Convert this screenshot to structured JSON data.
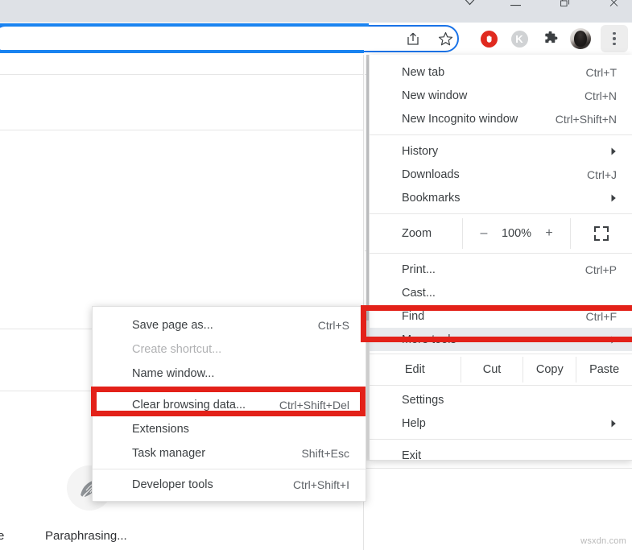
{
  "window": {
    "controls": [
      {
        "name": "chevron-down",
        "glyph": "chevron"
      },
      {
        "name": "minimize",
        "glyph": "minimize"
      },
      {
        "name": "restore",
        "glyph": "restore"
      },
      {
        "name": "close",
        "glyph": "close"
      }
    ]
  },
  "toolbar": {
    "omnibox_value": "",
    "omnibox_placeholder": "",
    "icons": [
      {
        "name": "share-icon",
        "label": "Share"
      },
      {
        "name": "bookmark-star-icon",
        "label": "Bookmark this tab"
      },
      {
        "name": "adblock-icon",
        "label": "AdBlock"
      },
      {
        "name": "kaspersky-icon",
        "label": "K"
      },
      {
        "name": "extensions-puzzle-icon",
        "label": "Extensions"
      },
      {
        "name": "avatar-icon",
        "label": "Profile"
      },
      {
        "name": "three-dot-menu-icon",
        "label": "Customize and control Google Chrome"
      }
    ]
  },
  "chrome_menu": {
    "groups": [
      {
        "items": [
          {
            "label": "New tab",
            "accel": "Ctrl+T",
            "arrow": false,
            "highlight": false
          },
          {
            "label": "New window",
            "accel": "Ctrl+N",
            "arrow": false,
            "highlight": false
          },
          {
            "label": "New Incognito window",
            "accel": "Ctrl+Shift+N",
            "arrow": false,
            "highlight": false
          }
        ]
      },
      {
        "items": [
          {
            "label": "History",
            "accel": "",
            "arrow": true,
            "highlight": false
          },
          {
            "label": "Downloads",
            "accel": "Ctrl+J",
            "arrow": false,
            "highlight": false
          },
          {
            "label": "Bookmarks",
            "accel": "",
            "arrow": true,
            "highlight": false
          }
        ]
      },
      {
        "zoom_row": {
          "label": "Zoom",
          "minus": "–",
          "value": "100%",
          "plus": "+",
          "fullscreen_icon": "fullscreen-icon"
        }
      },
      {
        "items": [
          {
            "label": "Print...",
            "accel": "Ctrl+P",
            "arrow": false,
            "highlight": false
          },
          {
            "label": "Cast...",
            "accel": "",
            "arrow": false,
            "highlight": false
          },
          {
            "label": "Find",
            "accel": "Ctrl+F",
            "arrow": false,
            "highlight": false
          },
          {
            "label": "More tools",
            "accel": "",
            "arrow": true,
            "highlight": true
          }
        ]
      },
      {
        "edit_row": {
          "label": "Edit",
          "cut": "Cut",
          "copy": "Copy",
          "paste": "Paste"
        }
      },
      {
        "items": [
          {
            "label": "Settings",
            "accel": "",
            "arrow": false,
            "highlight": false
          },
          {
            "label": "Help",
            "accel": "",
            "arrow": true,
            "highlight": false
          }
        ]
      },
      {
        "items": [
          {
            "label": "Exit",
            "accel": "",
            "arrow": false,
            "highlight": false
          }
        ]
      }
    ]
  },
  "more_tools_submenu": {
    "groups": [
      {
        "items": [
          {
            "label": "Save page as...",
            "accel": "Ctrl+S",
            "disabled": false
          },
          {
            "label": "Create shortcut...",
            "accel": "",
            "disabled": true
          },
          {
            "label": "Name window...",
            "accel": "",
            "disabled": false
          }
        ]
      },
      {
        "items": [
          {
            "label": "Clear browsing data...",
            "accel": "Ctrl+Shift+Del",
            "disabled": false
          },
          {
            "label": "Extensions",
            "accel": "",
            "disabled": false
          },
          {
            "label": "Task manager",
            "accel": "Shift+Esc",
            "disabled": false
          }
        ]
      },
      {
        "items": [
          {
            "label": "Developer tools",
            "accel": "Ctrl+Shift+I",
            "disabled": false
          }
        ]
      }
    ]
  },
  "page": {
    "feather_icon": "feather-quill-icon",
    "status_text": "Paraphrasing...",
    "edge_letter": "e",
    "watermark": "wsxdn.com"
  },
  "annotations": {
    "accent_color": "#e32119",
    "boxes": [
      {
        "name": "redbox-more-tools",
        "targets": "More tools"
      },
      {
        "name": "redbox-clear-data",
        "targets": "Clear browsing data..."
      }
    ]
  }
}
